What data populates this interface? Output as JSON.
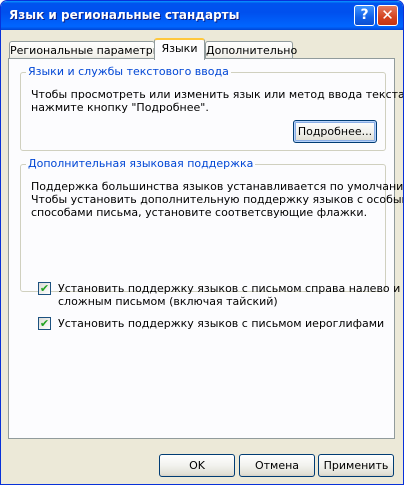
{
  "window": {
    "title": "Язык и региональные стандарты",
    "help_glyph": "?",
    "close_glyph": "✕"
  },
  "tabs": [
    {
      "label": "Региональные параметры",
      "selected": false
    },
    {
      "label": "Языки",
      "selected": true
    },
    {
      "label": "Дополнительно",
      "selected": false
    }
  ],
  "text_services": {
    "legend": "Языки и службы текстового ввода",
    "description_line1": "Чтобы просмотреть или изменить язык или метод ввода текста,",
    "description_line2": "нажмите кнопку \"Подробнее\".",
    "details_button": "Подробнее..."
  },
  "supplemental": {
    "legend": "Дополнительная языковая поддержка",
    "description_line1": "Поддержка большинства языков устанавливается по умолчанию.",
    "description_line2": "Чтобы установить дополнительную поддержку языков с особыми",
    "description_line3": "способами письма, установите соответсвующие флажки.",
    "complex_script": {
      "checked": true,
      "check_glyph": "✔",
      "label_line1": "Установить поддержку языков с письмом справа налево и",
      "label_line2": "сложным письмом (включая тайский)"
    },
    "east_asian": {
      "checked": true,
      "check_glyph": "✔",
      "label": "Установить поддержку языков с письмом иероглифами"
    }
  },
  "footer": {
    "ok": "OK",
    "cancel": "Отмена",
    "apply": "Применить"
  },
  "colors": {
    "titlebar": "#0053ee",
    "dialog_bg": "#ece9d8",
    "tab_page_bg": "#fcfcfe",
    "legend_text": "#0046d5",
    "active_tab_accent": "#ffc83c",
    "checkmark": "#21a121"
  }
}
